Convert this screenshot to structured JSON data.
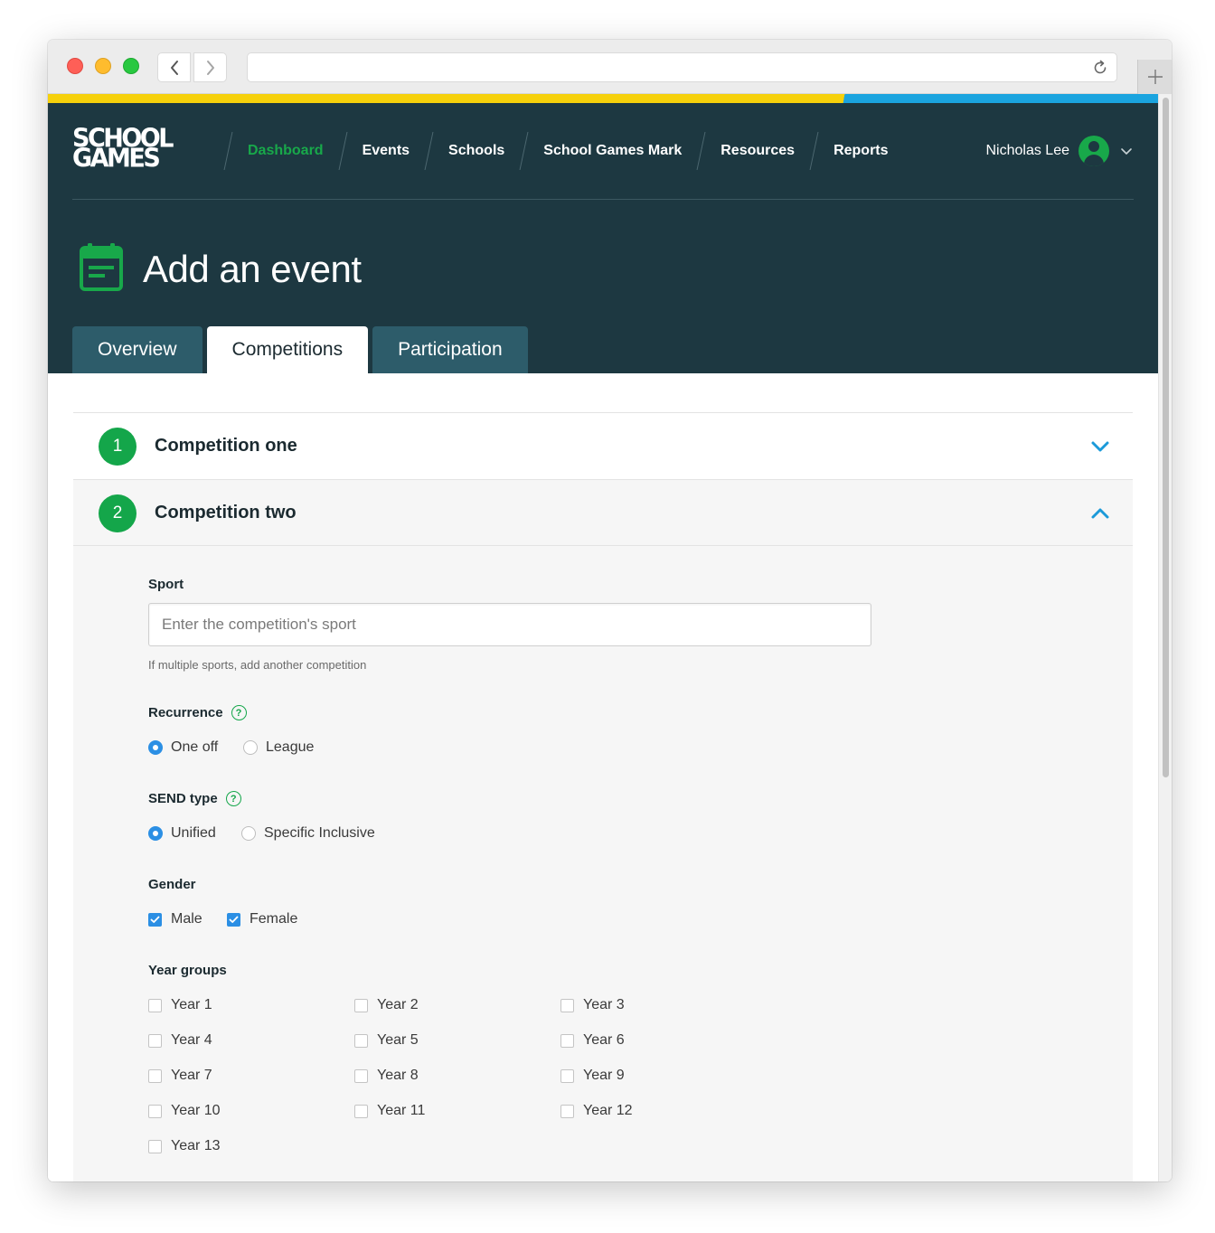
{
  "brand": {
    "logo_line1": "SCHOOL",
    "logo_line2": "GAMES"
  },
  "nav": [
    {
      "label": "Dashboard",
      "active": true
    },
    {
      "label": "Events"
    },
    {
      "label": "Schools"
    },
    {
      "label": "School Games Mark"
    },
    {
      "label": "Resources"
    },
    {
      "label": "Reports"
    }
  ],
  "user": {
    "name": "Nicholas Lee"
  },
  "page": {
    "title": "Add an event",
    "icon": "calendar-icon"
  },
  "tabs": [
    {
      "label": "Overview"
    },
    {
      "label": "Competitions",
      "active": true
    },
    {
      "label": "Participation"
    }
  ],
  "competitions": [
    {
      "number": "1",
      "title": "Competition one",
      "expanded": false
    },
    {
      "number": "2",
      "title": "Competition two",
      "expanded": true
    }
  ],
  "form": {
    "sport": {
      "label": "Sport",
      "placeholder": "Enter the competition's sport",
      "value": "",
      "hint": "If multiple sports, add another competition"
    },
    "recurrence": {
      "label": "Recurrence",
      "help": "?",
      "options": [
        {
          "label": "One off",
          "selected": true
        },
        {
          "label": "League",
          "selected": false
        }
      ]
    },
    "send_type": {
      "label": "SEND type",
      "help": "?",
      "options": [
        {
          "label": "Unified",
          "selected": true
        },
        {
          "label": "Specific Inclusive",
          "selected": false
        }
      ]
    },
    "gender": {
      "label": "Gender",
      "options": [
        {
          "label": "Male",
          "checked": true
        },
        {
          "label": "Female",
          "checked": true
        }
      ]
    },
    "year_groups": {
      "label": "Year groups",
      "options": [
        {
          "label": "Year 1",
          "checked": false
        },
        {
          "label": "Year 2",
          "checked": false
        },
        {
          "label": "Year 3",
          "checked": false
        },
        {
          "label": "Year 4",
          "checked": false
        },
        {
          "label": "Year 5",
          "checked": false
        },
        {
          "label": "Year 6",
          "checked": false
        },
        {
          "label": "Year 7",
          "checked": false
        },
        {
          "label": "Year 8",
          "checked": false
        },
        {
          "label": "Year 9",
          "checked": false
        },
        {
          "label": "Year 10",
          "checked": false
        },
        {
          "label": "Year 11",
          "checked": false
        },
        {
          "label": "Year 12",
          "checked": false
        },
        {
          "label": "Year 13",
          "checked": false
        }
      ]
    }
  },
  "colors": {
    "header_bg": "#1d3841",
    "tab_bg": "#2d5c6a",
    "accent_green": "#14a64a",
    "accent_blue": "#2b8fe4",
    "stripe_yellow": "#f6d10b",
    "stripe_blue": "#1aa4df"
  }
}
